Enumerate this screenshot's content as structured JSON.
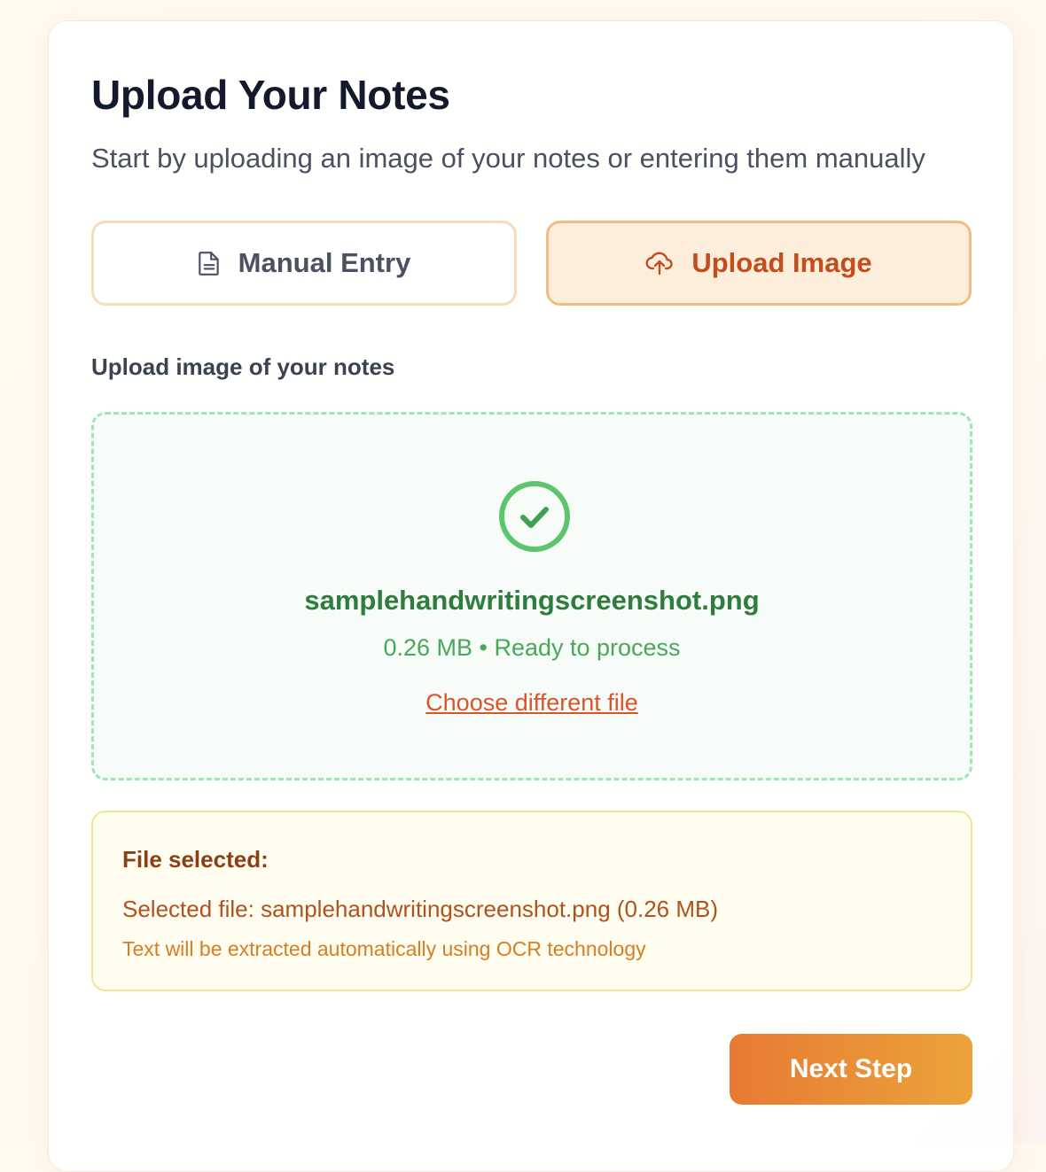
{
  "header": {
    "title": "Upload Your Notes",
    "subtitle": "Start by uploading an image of your notes or entering them manually"
  },
  "mode_toggle": {
    "manual_label": "Manual Entry",
    "manual_icon": "document-icon",
    "upload_label": "Upload Image",
    "upload_icon": "cloud-upload-icon",
    "selected": "Upload Image"
  },
  "upload": {
    "field_label": "Upload image of your notes",
    "status_icon": "check-circle-icon",
    "file_name": "samplehandwritingscreenshot.png",
    "file_meta": "0.26 MB • Ready to process",
    "change_link": "Choose different file"
  },
  "info": {
    "title": "File selected:",
    "selected_line": "Selected file: samplehandwritingscreenshot.png (0.26 MB)",
    "note": "Text will be extracted automatically using OCR technology"
  },
  "actions": {
    "next_label": "Next Step"
  },
  "colors": {
    "accent_orange": "#e77a33",
    "success_green": "#47a85a",
    "link_orange": "#d9542a",
    "title_dark": "#141a2e"
  }
}
